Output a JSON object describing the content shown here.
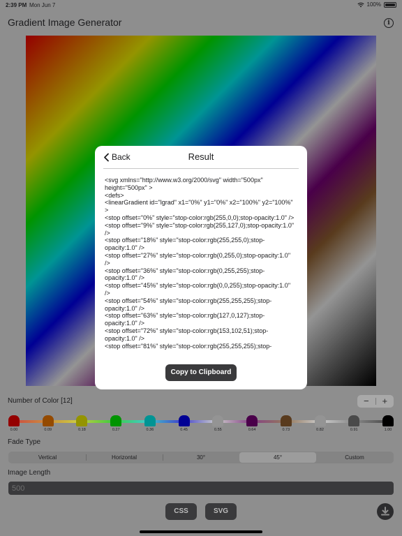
{
  "status_bar": {
    "time": "2:39 PM",
    "date": "Mon Jun 7",
    "battery": "100%"
  },
  "app": {
    "title": "Gradient Image Generator"
  },
  "number_of_colors": {
    "label": "Number of Color [12]",
    "minus": "−",
    "plus": "+"
  },
  "color_stops": [
    {
      "offset": "0.00",
      "color": "#ff0000"
    },
    {
      "offset": "0.09",
      "color": "#ff7f00"
    },
    {
      "offset": "0.18",
      "color": "#ffff00"
    },
    {
      "offset": "0.27",
      "color": "#00ff00"
    },
    {
      "offset": "0.36",
      "color": "#00ffff"
    },
    {
      "offset": "0.45",
      "color": "#0000ff"
    },
    {
      "offset": "0.55",
      "color": "#ffffff"
    },
    {
      "offset": "0.64",
      "color": "#7f007f"
    },
    {
      "offset": "0.73",
      "color": "#996633"
    },
    {
      "offset": "0.82",
      "color": "#ffffff"
    },
    {
      "offset": "0.91",
      "color": "#808080"
    },
    {
      "offset": "1.00",
      "color": "#000000"
    }
  ],
  "fade_type": {
    "label": "Fade Type",
    "options": [
      "Vertical",
      "Horizontal",
      "30°",
      "45°",
      "Custom"
    ],
    "selected": "45°"
  },
  "image_length": {
    "label": "Image Length",
    "placeholder": "500"
  },
  "buttons": {
    "css": "CSS",
    "svg": "SVG"
  },
  "modal": {
    "back_label": "Back",
    "title": "Result",
    "code": "<svg xmlns=\"http://www.w3.org/2000/svg\" width=\"500px\" height=\"500px\" >\n<defs>\n<linearGradient id=\"lgrad\" x1=\"0%\" y1=\"0%\" x2=\"100%\" y2=\"100%\" >\n<stop offset=\"0%\" style=\"stop-color:rgb(255,0,0);stop-opacity:1.0\" />\n<stop offset=\"9%\" style=\"stop-color:rgb(255,127,0);stop-opacity:1.0\" />\n<stop offset=\"18%\" style=\"stop-color:rgb(255,255,0);stop-opacity:1.0\" />\n<stop offset=\"27%\" style=\"stop-color:rgb(0,255,0);stop-opacity:1.0\" />\n<stop offset=\"36%\" style=\"stop-color:rgb(0,255,255);stop-opacity:1.0\" />\n<stop offset=\"45%\" style=\"stop-color:rgb(0,0,255);stop-opacity:1.0\" />\n<stop offset=\"54%\" style=\"stop-color:rgb(255,255,255);stop-opacity:1.0\" />\n<stop offset=\"63%\" style=\"stop-color:rgb(127,0,127);stop-opacity:1.0\" />\n<stop offset=\"72%\" style=\"stop-color:rgb(153,102,51);stop-opacity:1.0\" />\n<stop offset=\"81%\" style=\"stop-color:rgb(255,255,255);stop-",
    "copy_label": "Copy to Clipboard"
  }
}
